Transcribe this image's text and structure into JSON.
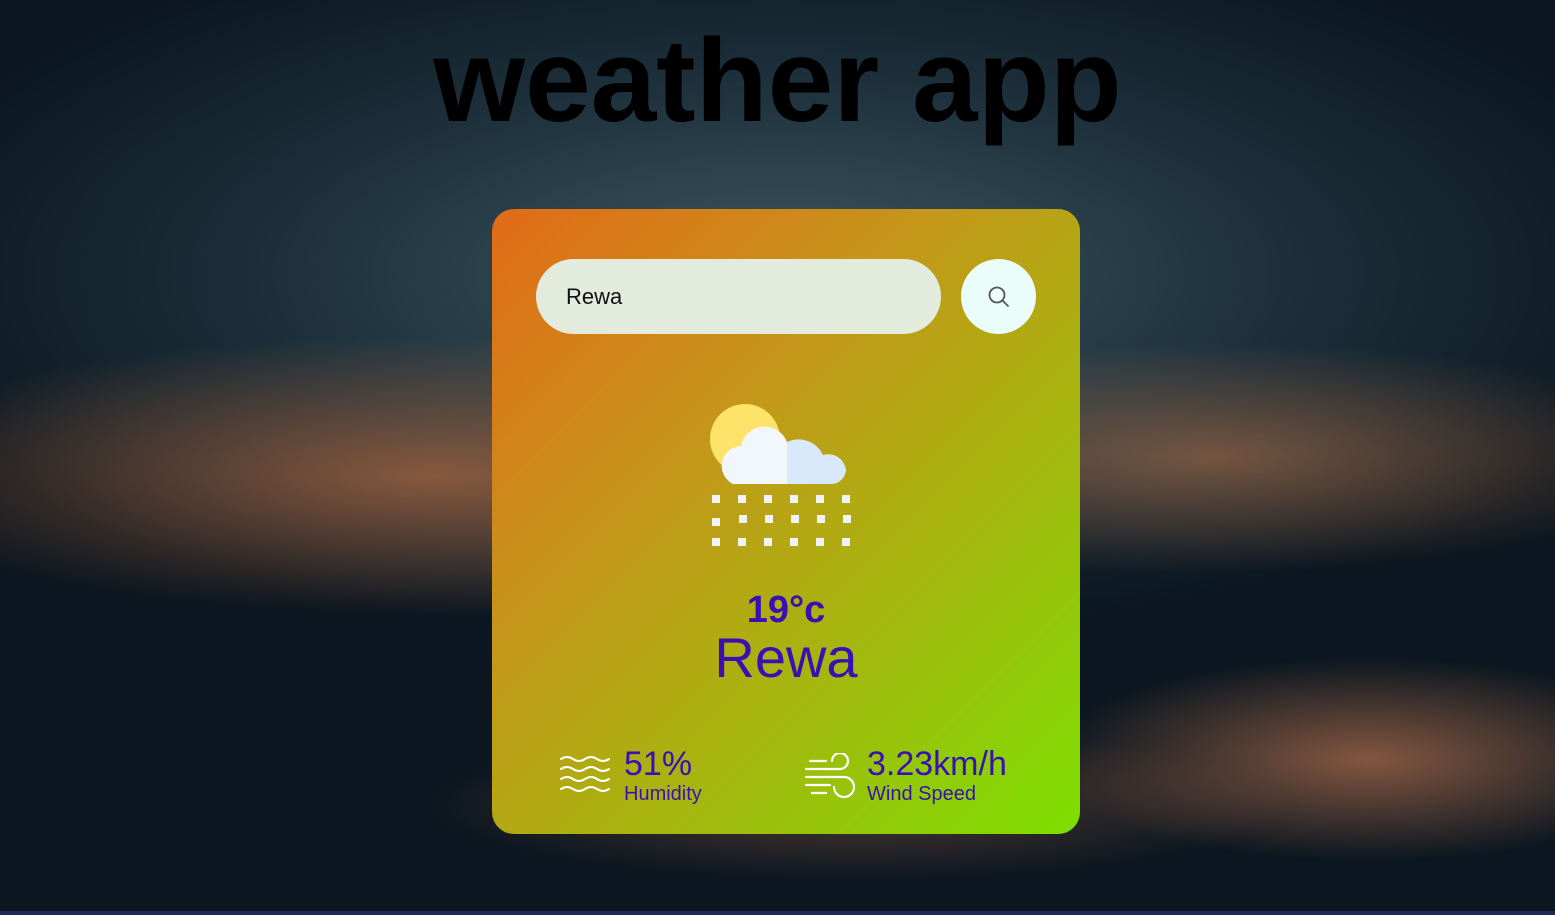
{
  "app": {
    "title": "weather app"
  },
  "search": {
    "value": "Rewa",
    "button_icon": "search-icon"
  },
  "weather": {
    "icon": "sun-cloud-snow-icon",
    "temperature": "19°c",
    "city": "Rewa"
  },
  "details": {
    "humidity": {
      "value": "51%",
      "label": "Humidity",
      "icon": "humidity-waves-icon"
    },
    "wind": {
      "value": "3.23km/h",
      "label": "Wind Speed",
      "icon": "wind-icon"
    }
  },
  "colors": {
    "text_accent": "#3a0fb3",
    "card_gradient_start": "#e26a18",
    "card_gradient_end": "#7ddf02",
    "search_bg": "#e3ebdd",
    "button_bg": "#eafdfb"
  }
}
